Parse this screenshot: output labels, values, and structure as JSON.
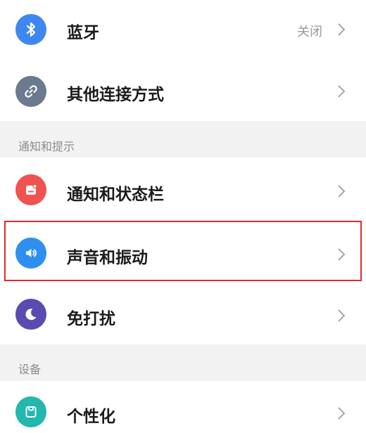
{
  "rows": [
    {
      "label": "蓝牙",
      "value": "关闭",
      "icon": "bluetooth-icon",
      "icon_color": "#3e87f0"
    },
    {
      "label": "其他连接方式",
      "icon": "link-icon",
      "icon_color": "#6b7a8f"
    },
    {
      "label": "通知和状态栏",
      "icon": "notification-icon",
      "icon_color": "#ef5350"
    },
    {
      "label": "声音和振动",
      "icon": "speaker-icon",
      "icon_color": "#2f8ff0"
    },
    {
      "label": "免打扰",
      "icon": "moon-icon",
      "icon_color": "#5a4bb0"
    },
    {
      "label": "个性化",
      "icon": "personalization-icon",
      "icon_color": "#23b7ae"
    }
  ],
  "sections": [
    {
      "title": "通知和提示"
    },
    {
      "title": "设备"
    }
  ],
  "colors": {
    "highlight_border": "#e2292b",
    "section_background": "#f2f2f2"
  }
}
